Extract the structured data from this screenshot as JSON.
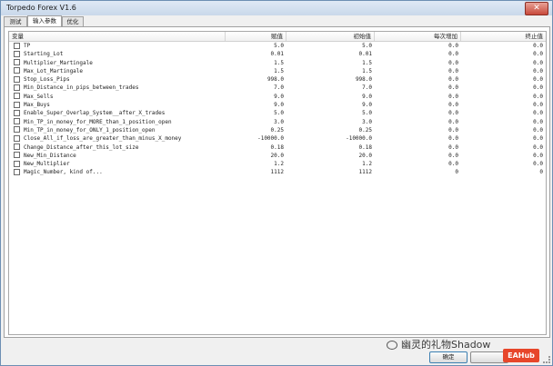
{
  "window": {
    "title": "Torpedo Forex V1.6",
    "close_glyph": "✕"
  },
  "tabs": [
    {
      "label": "测试"
    },
    {
      "label": "输入参数"
    },
    {
      "label": "优化"
    }
  ],
  "table": {
    "columns": [
      "变量",
      "赋值",
      "初始值",
      "每次增加",
      "终止值"
    ],
    "rows": [
      [
        "TP",
        "5.0",
        "5.0",
        "0.0",
        "0.0"
      ],
      [
        "Starting_Lot",
        "0.01",
        "0.01",
        "0.0",
        "0.0"
      ],
      [
        "Multiplier_Martingale",
        "1.5",
        "1.5",
        "0.0",
        "0.0"
      ],
      [
        "Max_Lot_Martingale",
        "1.5",
        "1.5",
        "0.0",
        "0.0"
      ],
      [
        "Stop_Loss_Pips",
        "998.0",
        "998.0",
        "0.0",
        "0.0"
      ],
      [
        "Min_Distance_in_pips_between_trades",
        "7.0",
        "7.0",
        "0.0",
        "0.0"
      ],
      [
        "Max_Sells",
        "9.0",
        "9.0",
        "0.0",
        "0.0"
      ],
      [
        "Max_Buys",
        "9.0",
        "9.0",
        "0.0",
        "0.0"
      ],
      [
        "Enable_Super_Overlap_System__after_X_trades",
        "5.0",
        "5.0",
        "0.0",
        "0.0"
      ],
      [
        "Min_TP_in_money_for_MORE_than_1_position_open",
        "3.0",
        "3.0",
        "0.0",
        "0.0"
      ],
      [
        "Min_TP_in_money_for_ONLY_1_position_open",
        "0.25",
        "0.25",
        "0.0",
        "0.0"
      ],
      [
        "Close_All_if_loss_are_greater_than_minus_X_money",
        "-10000.0",
        "-10000.0",
        "0.0",
        "0.0"
      ],
      [
        "Change_Distance_after_this_lot_size",
        "0.18",
        "0.18",
        "0.0",
        "0.0"
      ],
      [
        "New_Min_Distance",
        "20.0",
        "20.0",
        "0.0",
        "0.0"
      ],
      [
        "New_Multiplier",
        "1.2",
        "1.2",
        "0.0",
        "0.0"
      ],
      [
        "Magic_Number, kind of...",
        "1112",
        "1112",
        "0",
        "0"
      ]
    ]
  },
  "buttons": {
    "ok": "确定"
  },
  "watermark": {
    "text": "幽灵的礼物Shadow",
    "brand": "EAHub"
  }
}
